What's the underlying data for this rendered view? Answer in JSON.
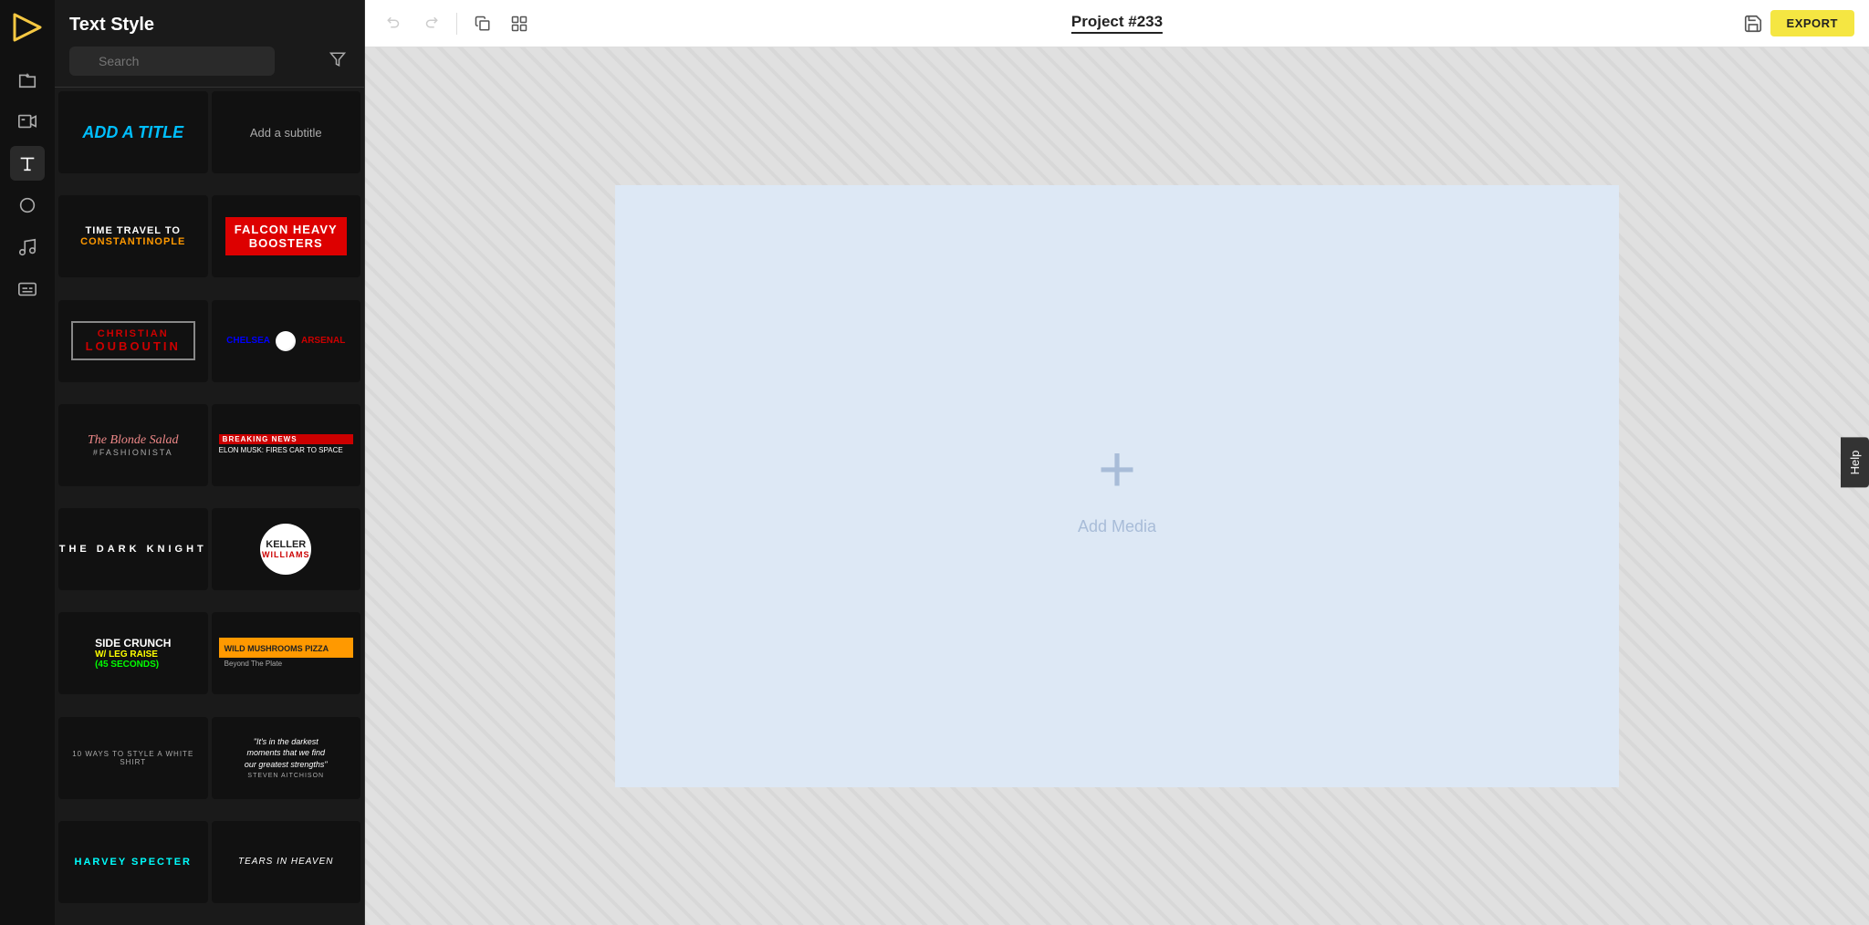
{
  "app": {
    "logo_symbol": "▷",
    "title": "Text Style"
  },
  "sidebar": {
    "icons": [
      {
        "name": "folder-upload-icon",
        "symbol": "📁",
        "active": false
      },
      {
        "name": "video-icon",
        "symbol": "▶",
        "active": false
      },
      {
        "name": "text-icon",
        "symbol": "T",
        "active": true
      },
      {
        "name": "shapes-icon",
        "symbol": "○",
        "active": false
      },
      {
        "name": "music-icon",
        "symbol": "♪",
        "active": false
      },
      {
        "name": "captions-icon",
        "symbol": "CC",
        "active": false
      }
    ]
  },
  "panel": {
    "title": "Text Style",
    "search_placeholder": "Search"
  },
  "toolbar": {
    "undo_label": "↩",
    "redo_label": "↪",
    "duplicate_label": "⧉",
    "group_label": "⊞",
    "project_title": "Project #233",
    "export_label": "EXPORT"
  },
  "canvas": {
    "add_media_label": "Add Media"
  },
  "help": {
    "label": "Help"
  },
  "templates": [
    {
      "id": "add-title",
      "type": "add-title"
    },
    {
      "id": "add-subtitle",
      "type": "add-subtitle"
    },
    {
      "id": "time-travel",
      "type": "time-travel"
    },
    {
      "id": "falcon-heavy",
      "type": "falcon-heavy"
    },
    {
      "id": "christian-louboutin",
      "type": "christian-louboutin"
    },
    {
      "id": "chelsea-arsenal",
      "type": "chelsea-arsenal"
    },
    {
      "id": "blonde-salad",
      "type": "blonde-salad"
    },
    {
      "id": "breaking-news",
      "type": "breaking-news"
    },
    {
      "id": "dark-knight",
      "type": "dark-knight"
    },
    {
      "id": "keller-williams",
      "type": "keller-williams"
    },
    {
      "id": "side-crunch",
      "type": "side-crunch"
    },
    {
      "id": "wild-mushrooms",
      "type": "wild-mushrooms"
    },
    {
      "id": "white-shirt",
      "type": "white-shirt"
    },
    {
      "id": "quote",
      "type": "quote"
    },
    {
      "id": "harvey-specter",
      "type": "harvey-specter"
    },
    {
      "id": "tears-in-heaven",
      "type": "tears-in-heaven"
    }
  ]
}
